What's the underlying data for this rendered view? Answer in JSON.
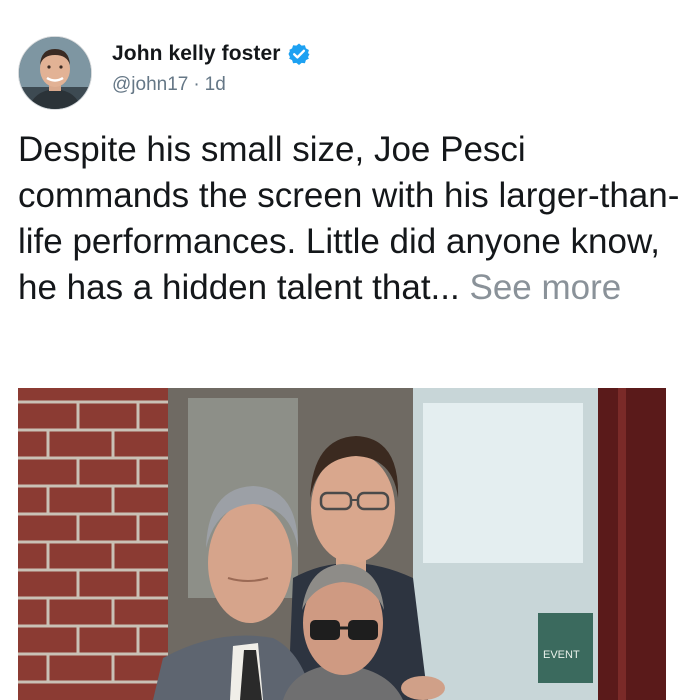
{
  "post": {
    "author_name": "John kelly foster",
    "handle": "@john17",
    "separator": "·",
    "timestamp": "1d",
    "verified_badge": "verified-check-icon",
    "body": "Despite his small size, Joe Pesci commands the screen with his larger-than-life performances. Little did anyone know, he has a hidden talent that...",
    "see_more": "See more",
    "sign_text": "EVENT"
  },
  "colors": {
    "verified": "#1da1f2",
    "secondary_text": "#657786",
    "see_more": "#8a9299"
  }
}
